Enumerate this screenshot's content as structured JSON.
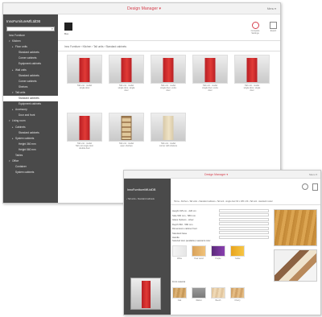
{
  "colors": {
    "accent": "#d6404e",
    "sidebar_bg": "#4a4a4a",
    "cabinet_red": "#d62f2f"
  },
  "window_main": {
    "title": "Design Manager ▾",
    "corner_label": "Menu ▾",
    "logo_text": "Box",
    "toolbar": [
      "Compare Settings",
      "Export"
    ],
    "sidebar": {
      "heading": "InnoFurnitureMfLtdDB",
      "items": [
        {
          "label": "Inno Furniture",
          "level": 0,
          "arrow": ""
        },
        {
          "label": "Kitchen",
          "level": 1,
          "arrow": "▾"
        },
        {
          "label": "Floor units",
          "level": 2,
          "arrow": "▸"
        },
        {
          "label": "Standard cabinets",
          "level": 3,
          "arrow": ""
        },
        {
          "label": "Corner cabinets",
          "level": 3,
          "arrow": ""
        },
        {
          "label": "Equipment cabinets",
          "level": 3,
          "arrow": ""
        },
        {
          "label": "Wall units",
          "level": 2,
          "arrow": "▸"
        },
        {
          "label": "Standard cabinets",
          "level": 3,
          "arrow": ""
        },
        {
          "label": "Corner cabinets",
          "level": 3,
          "arrow": ""
        },
        {
          "label": "Shelves",
          "level": 3,
          "arrow": ""
        },
        {
          "label": "Tall units",
          "level": 2,
          "arrow": "▾"
        },
        {
          "label": "Standard cabinets",
          "level": 3,
          "arrow": "",
          "selected": true
        },
        {
          "label": "Equipment cabinets",
          "level": 3,
          "arrow": ""
        },
        {
          "label": "Accessory",
          "level": 2,
          "arrow": "▸"
        },
        {
          "label": "Door and front",
          "level": 3,
          "arrow": ""
        },
        {
          "label": "Living room",
          "level": 1,
          "arrow": "▾"
        },
        {
          "label": "Cabinets",
          "level": 2,
          "arrow": "▸"
        },
        {
          "label": "Standard cabinets",
          "level": 3,
          "arrow": ""
        },
        {
          "label": "System cabinets",
          "level": 2,
          "arrow": "▸"
        },
        {
          "label": "Height 360 mm",
          "level": 3,
          "arrow": ""
        },
        {
          "label": "Height 560 mm",
          "level": 3,
          "arrow": ""
        },
        {
          "label": "Tables",
          "level": 2,
          "arrow": ""
        },
        {
          "label": "Office",
          "level": 1,
          "arrow": "▾"
        },
        {
          "label": "Container",
          "level": 2,
          "arrow": ""
        },
        {
          "label": "System cabinets",
          "level": 2,
          "arrow": ""
        }
      ]
    },
    "breadcrumb": "Inno Furniture  ›  Kitchen  ›  Tall units  ›  Standard cabinets",
    "products": [
      {
        "caption": [
          "Tall unit - model",
          "single door"
        ],
        "style": "red"
      },
      {
        "caption": [
          "Tall unit - model",
          "single door, single",
          "door"
        ],
        "style": "red"
      },
      {
        "caption": [
          "Tall unit - model",
          "single door, extra",
          "door"
        ],
        "style": "red"
      },
      {
        "caption": [
          "Tall unit - model",
          "single door, extra",
          "door"
        ],
        "style": "red"
      },
      {
        "caption": [
          "Tall unit - model",
          "single door, single",
          "door"
        ],
        "style": "red"
      },
      {
        "caption": [
          "Tall unit - model",
          "Tall unit single door",
          "double door"
        ],
        "style": "red"
      },
      {
        "caption": [
          "Tall unit - model",
          "open shelves"
        ],
        "style": "oak"
      },
      {
        "caption": [
          "Tall unit - model",
          "corner with shelves"
        ],
        "style": "beige"
      }
    ]
  },
  "window_detail": {
    "title": "Design Manager ▾",
    "corner_label": "Menu ▾",
    "sidebar_heading": "InnoFurnitureMfLtdDB",
    "sidebar_back": "‹  Tall units  ›  Standard cabinets",
    "breadcrumb": "Home  ›  Kitchen  ›  Tall units  ›  Standard cabinets  ›  Tall unit - single door 60 x 195 x 60  ›  Tall unit - standard model",
    "form_rows": [
      "Height 195 cm - 220 cm",
      "Side 500 mm - 580 mm",
      "Glass Options - silver",
      "Depth 560 - 580 mm",
      "Dimensions cabinet front",
      "Standard base",
      "Handle"
    ],
    "swatch_heading": "Selected door (available) material & color",
    "front_heading": "Front material",
    "door_swatches": [
      "White",
      "Pear wood",
      "Purple",
      "Yellow"
    ],
    "front_swatches": [
      "Oak",
      "Walnut",
      "Beech",
      "Cherry"
    ]
  }
}
